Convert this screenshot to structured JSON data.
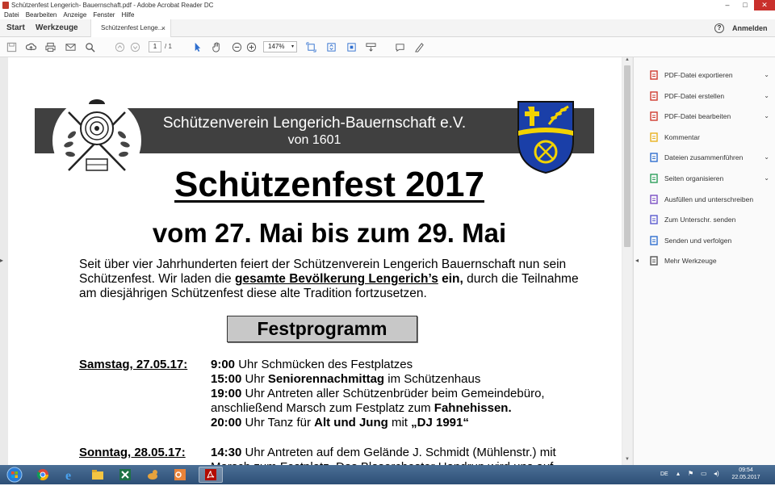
{
  "window": {
    "title": "Schützenfest Lengerich- Bauernschaft.pdf - Adobe Acrobat Reader DC",
    "controls": {
      "minimize": "–",
      "maximize": "□",
      "close": "✕"
    }
  },
  "menu": [
    "Datei",
    "Bearbeiten",
    "Anzeige",
    "Fenster",
    "Hilfe"
  ],
  "tabs": {
    "home": "Start",
    "tools": "Werkzeuge",
    "document": "Schützenfest Lenge...",
    "close_symbol": "×",
    "help_symbol": "?",
    "signin": "Anmelden"
  },
  "toolbar": {
    "page_current": "1",
    "page_total": "/ 1",
    "zoom": "147%",
    "zoom_caret": "▾"
  },
  "document": {
    "club_name": "Schützenverein Lengerich-Bauernschaft e.V.",
    "club_year": "von 1601",
    "title": "Schützenfest 2017",
    "dates": "vom 27. Mai bis zum 29. Mai",
    "intro": {
      "p1": "Seit über vier Jahrhunderten feiert der Schützenverein Lengerich Bauernschaft nun sein Schützenfest. Wir laden die ",
      "p2": "gesamte Bevölkerung Lengerich’s",
      "p3": " ein,",
      "p4": " durch die Teilnahme am diesjährigen Schützenfest diese alte Tradition fortzusetzen."
    },
    "program_heading": "Festprogramm",
    "days": [
      {
        "label": "Samstag, 27.05.17:",
        "events": [
          {
            "time": "9:00",
            "pre": " Uhr Schmücken des Festplatzes",
            "bold": "",
            "post": ""
          },
          {
            "time": "15:00",
            "pre": " Uhr ",
            "bold": "Seniorennachmittag",
            "post": " im Schützenhaus"
          },
          {
            "time": "19:00",
            "pre": " Uhr Antreten aller Schützenbrüder beim Gemeindebüro, anschließend  Marsch zum Festplatz zum ",
            "bold": "Fahnehissen.",
            "post": ""
          },
          {
            "time": "20:00",
            "pre": " Uhr Tanz für ",
            "bold": "Alt und Jung",
            "post": " mit  ",
            "bold2": "„DJ 1991“"
          }
        ]
      },
      {
        "label": "Sonntag, 28.05.17:",
        "events": [
          {
            "time": "14:30",
            "pre": " Uhr Antreten auf dem Gelände J. Schmidt (Mühlenstr.) mit Marsch zum Festplatz. Das Blasorchester Handrup wird uns auf",
            "bold": "",
            "post": ""
          }
        ]
      }
    ]
  },
  "right_pane": {
    "items": [
      {
        "label": "PDF-Datei exportieren",
        "icon": "export-pdf-icon",
        "color": "#d03a2f",
        "chevron": "⌄"
      },
      {
        "label": "PDF-Datei erstellen",
        "icon": "create-pdf-icon",
        "color": "#d03a2f",
        "chevron": "⌄"
      },
      {
        "label": "PDF-Datei bearbeiten",
        "icon": "edit-pdf-icon",
        "color": "#d03a2f",
        "chevron": "⌄"
      },
      {
        "label": "Kommentar",
        "icon": "comment-icon",
        "color": "#e9b11e",
        "chevron": ""
      },
      {
        "label": "Dateien zusammenführen",
        "icon": "combine-files-icon",
        "color": "#2f6fcf",
        "chevron": "⌄"
      },
      {
        "label": "Seiten organisieren",
        "icon": "organize-pages-icon",
        "color": "#2c9e5a",
        "chevron": "⌄"
      },
      {
        "label": "Ausfüllen und unterschreiben",
        "icon": "fill-sign-icon",
        "color": "#7b4fc4",
        "chevron": ""
      },
      {
        "label": "Zum Unterschr. senden",
        "icon": "send-signature-icon",
        "color": "#5a5ad0",
        "chevron": ""
      },
      {
        "label": "Senden und verfolgen",
        "icon": "send-track-icon",
        "color": "#2f6fcf",
        "chevron": ""
      },
      {
        "label": "Mehr Werkzeuge",
        "icon": "more-tools-icon",
        "color": "#555555",
        "chevron": ""
      }
    ]
  },
  "taskbar": {
    "language": "DE",
    "time": "09:54",
    "date": "22.05.2017"
  }
}
